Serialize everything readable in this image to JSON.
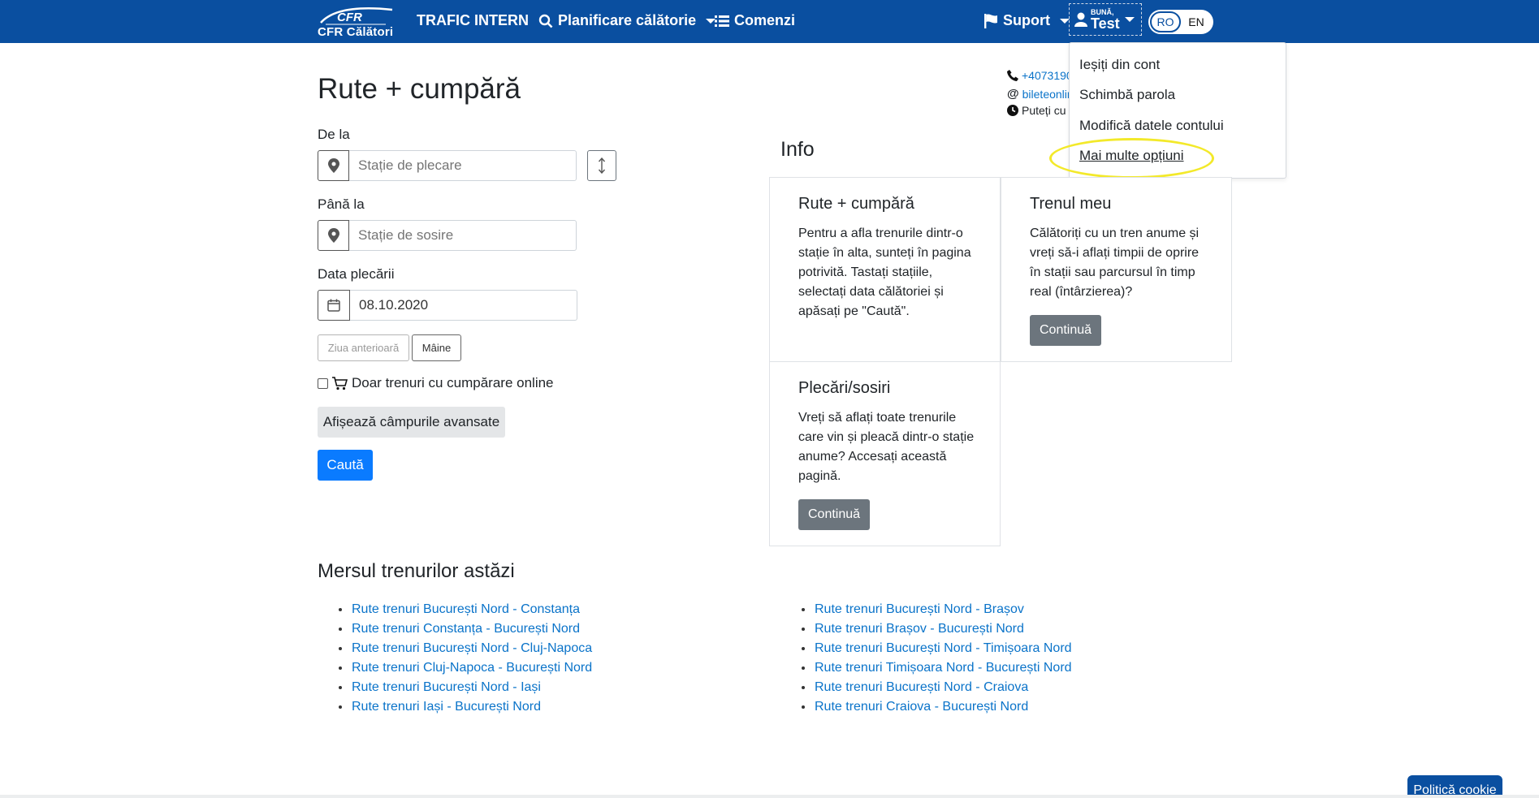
{
  "nav": {
    "logo_text": "CFR Călători",
    "logo_mark": "CFR",
    "trafic": "TRAFIC INTERN",
    "planificare": "Planificare călătorie",
    "comenzi": "Comenzi",
    "suport": "Suport",
    "user_hello": "BUNĂ,",
    "user_name": "Test",
    "lang_ro": "RO",
    "lang_en": "EN"
  },
  "contact": {
    "phone": "+4073190",
    "email": "bileteonlin",
    "hours": "Puteți cu"
  },
  "dropdown": {
    "items": [
      "Ieșiți din cont",
      "Schimbă parola",
      "Modifică datele contului",
      "Mai multe opțiuni"
    ]
  },
  "form": {
    "title": "Rute + cumpără",
    "from_label": "De la",
    "from_placeholder": "Stație de plecare",
    "to_label": "Până la",
    "to_placeholder": "Stație de sosire",
    "date_label": "Data plecării",
    "date_value": "08.10.2020",
    "prev_day": "Ziua anterioară",
    "tomorrow": "Mâine",
    "online_only": "Doar trenuri cu cumpărare online",
    "advanced": "Afișează câmpurile avansate",
    "search": "Caută"
  },
  "info": {
    "title": "Info",
    "cards": [
      {
        "title": "Rute + cumpără",
        "text": "Pentru a afla trenurile dintr-o stație în alta, sunteți în pagina potrivită. Tastați stațiile, selectați data călătoriei și apăsați pe \"Caută\"."
      },
      {
        "title": "Trenul meu",
        "text": "Călătoriți cu un tren anume și vreți să-i aflați timpii de oprire în stații sau parcursul în timp real (întârzierea)?",
        "button": "Continuă"
      },
      {
        "title": "Plecări/sosiri",
        "text": "Vreți să aflați toate trenurile care vin și pleacă dintr-o stație anume? Accesați această pagină.",
        "button": "Continuă"
      }
    ]
  },
  "schedule": {
    "title": "Mersul trenurilor astăzi",
    "left": [
      "Rute trenuri București Nord - Constanța",
      "Rute trenuri Constanța - București Nord",
      "Rute trenuri București Nord - Cluj-Napoca",
      "Rute trenuri Cluj-Napoca - București Nord",
      "Rute trenuri București Nord - Iași",
      "Rute trenuri Iași - București Nord"
    ],
    "right": [
      "Rute trenuri București Nord - Brașov",
      "Rute trenuri Brașov - București Nord",
      "Rute trenuri București Nord - Timișoara Nord",
      "Rute trenuri Timișoara Nord - București Nord",
      "Rute trenuri București Nord - Craiova",
      "Rute trenuri Craiova - București Nord"
    ]
  },
  "cookie": "Politică cookie",
  "colors": {
    "navbar": "#0a4fa0",
    "primary": "#0a7bff",
    "link": "#0a73c9",
    "highlight": "#f3e92a"
  }
}
